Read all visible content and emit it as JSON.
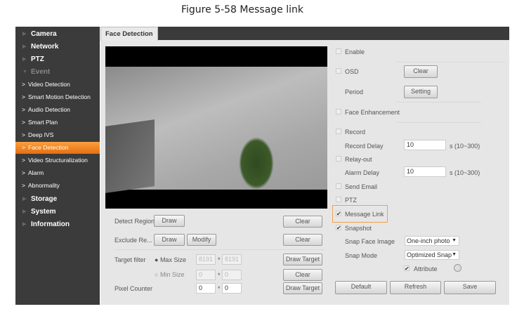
{
  "caption": "Figure 5-58 Message link",
  "sidebar": {
    "top": [
      "Camera",
      "Network",
      "PTZ"
    ],
    "event": "Event",
    "event_items": [
      "Video Detection",
      "Smart Motion Detection",
      "Audio Detection",
      "Smart Plan",
      "Deep IVS",
      "Face Detection",
      "Video Structuralization",
      "Alarm",
      "Abnormality"
    ],
    "active": "Face Detection",
    "bottom": [
      "Storage",
      "System",
      "Information"
    ]
  },
  "tab": "Face Detection",
  "left": {
    "detect_region": "Detect Region",
    "draw": "Draw",
    "clear": "Clear",
    "exclude_region": "Exclude Re...",
    "modify": "Modify",
    "target_filter": "Target filter",
    "max_size": "Max Size",
    "max_w": "8191",
    "max_h": "8191",
    "min_size": "Min Size",
    "min_w": "0",
    "min_h": "0",
    "draw_target": "Draw Target",
    "pixel_counter": "Pixel Counter",
    "pc_w": "0",
    "pc_h": "0",
    "times": "*"
  },
  "right": {
    "enable": "Enable",
    "osd": "OSD",
    "clear": "Clear",
    "period": "Period",
    "setting": "Setting",
    "face_enhancement": "Face Enhancement",
    "record": "Record",
    "record_delay": "Record Delay",
    "record_delay_value": "10",
    "range": "s (10~300)",
    "relay_out": "Relay-out",
    "alarm_delay": "Alarm Delay",
    "alarm_delay_value": "10",
    "send_email": "Send Email",
    "ptz": "PTZ",
    "message_link": "Message Link",
    "snapshot": "Snapshot",
    "snap_face_image": "Snap Face Image",
    "snap_face_value": "One-inch photo",
    "snap_mode": "Snap Mode",
    "snap_mode_value": "Optimized Snap",
    "attribute": "Attribute",
    "default": "Default",
    "refresh": "Refresh",
    "save": "Save"
  },
  "checks": {
    "enable": false,
    "osd": false,
    "face_enhancement": false,
    "record": false,
    "relay_out": false,
    "send_email": false,
    "ptz": false,
    "message_link": true,
    "snapshot": true,
    "attribute": true
  },
  "colors": {
    "accent": "#f08020",
    "highlight": "#f3a14a",
    "sidebar": "#3b3b3b"
  }
}
